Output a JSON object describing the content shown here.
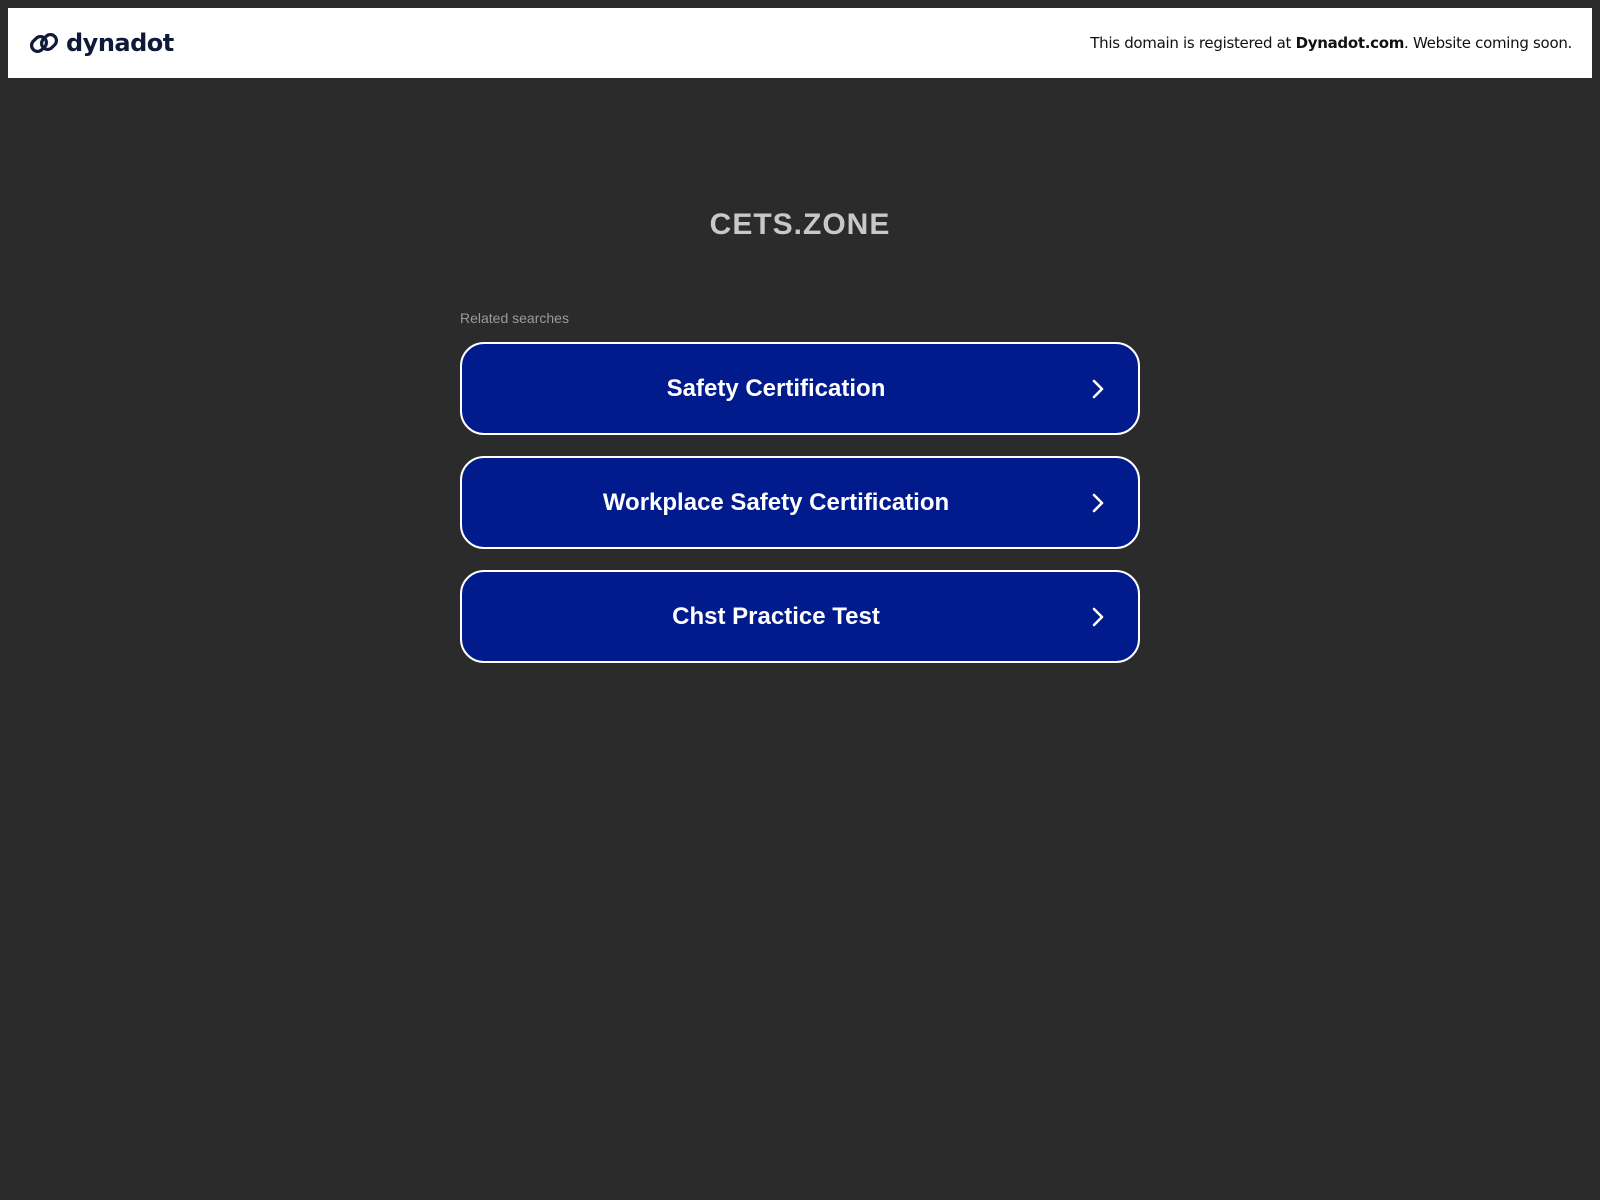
{
  "header": {
    "brand_name": "dynadot",
    "brand_icon": "link-logo-icon",
    "notice_prefix": "This domain is registered at ",
    "notice_link": "Dynadot.com",
    "notice_suffix": ". Website coming soon."
  },
  "main": {
    "domain": "CETS.ZONE",
    "related_label": "Related searches",
    "searches": [
      {
        "label": "Safety Certification",
        "icon": "chevron-right-icon"
      },
      {
        "label": "Workplace Safety Certification",
        "icon": "chevron-right-icon"
      },
      {
        "label": "Chst Practice Test",
        "icon": "chevron-right-icon"
      }
    ]
  },
  "colors": {
    "background": "#2b2b2b",
    "topbar": "#ffffff",
    "button": "#011a8c",
    "button_border": "#ffffff",
    "brand": "#0f1a3a",
    "domain_title": "#c8c8c8",
    "related_label": "#9a9a9a"
  }
}
